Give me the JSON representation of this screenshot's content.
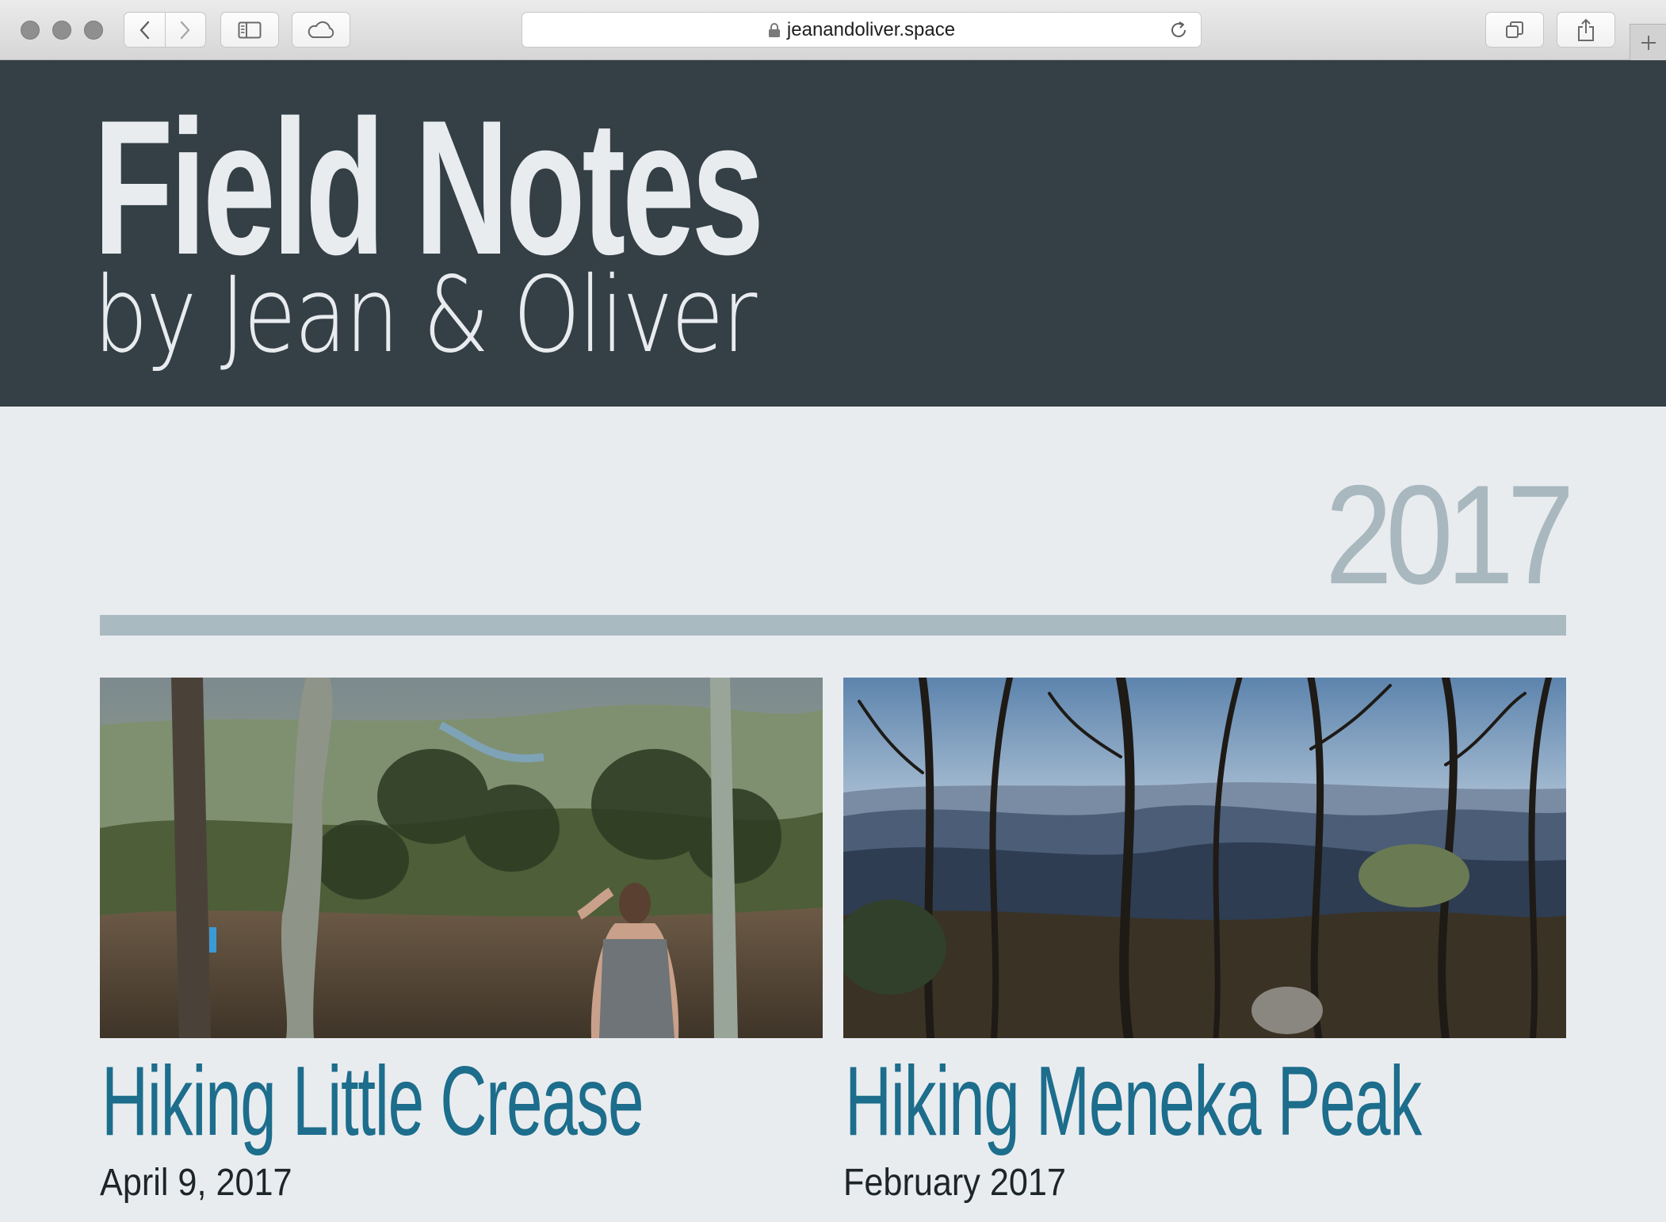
{
  "browser": {
    "url": "jeanandoliver.space",
    "icons": [
      "back-icon",
      "forward-icon",
      "sidebar-icon",
      "icloud-icon",
      "lock-icon",
      "reload-icon",
      "tabs-overview-icon",
      "share-icon",
      "new-tab-icon"
    ]
  },
  "site": {
    "title": "Field Notes",
    "subtitle": "by Jean & Oliver"
  },
  "section": {
    "year": "2017"
  },
  "posts": [
    {
      "title": "Hiking Little Crease",
      "date": "April 9, 2017"
    },
    {
      "title": "Hiking Meneka Peak",
      "date": "February 2017"
    }
  ],
  "colors": {
    "header_bg": "#343f46",
    "page_bg": "#e9ecef",
    "accent_title": "#1d6d8c",
    "year_gray": "#a9b8bf"
  }
}
